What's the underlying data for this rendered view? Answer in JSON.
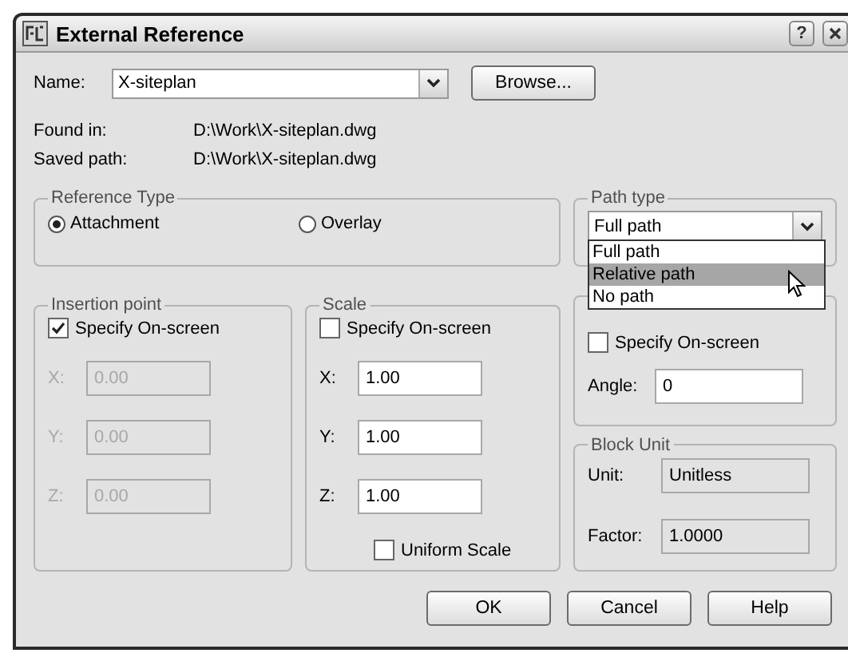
{
  "window": {
    "title": "External Reference",
    "help_button": "?"
  },
  "name": {
    "label": "Name:",
    "value": "X-siteplan"
  },
  "browse_button": "Browse...",
  "info": [
    {
      "label": "Found in:",
      "value": "D:\\Work\\X-siteplan.dwg"
    },
    {
      "label": "Saved path:",
      "value": "D:\\Work\\X-siteplan.dwg"
    }
  ],
  "reference_type": {
    "title": "Reference Type",
    "options": [
      {
        "label": "Attachment",
        "selected": true
      },
      {
        "label": "Overlay",
        "selected": false
      }
    ]
  },
  "path_type": {
    "title": "Path type",
    "value": "Full path",
    "expanded": true,
    "options": [
      {
        "label": "Full path",
        "highlighted": false
      },
      {
        "label": "Relative path",
        "highlighted": true
      },
      {
        "label": "No path",
        "highlighted": false
      }
    ]
  },
  "insertion_point": {
    "title": "Insertion point",
    "specify_on_screen": {
      "label": "Specify On-screen",
      "checked": true
    },
    "fields": [
      {
        "label": "X:",
        "value": "0.00",
        "disabled": true
      },
      {
        "label": "Y:",
        "value": "0.00",
        "disabled": true
      },
      {
        "label": "Z:",
        "value": "0.00",
        "disabled": true
      }
    ]
  },
  "scale": {
    "title": "Scale",
    "specify_on_screen": {
      "label": "Specify On-screen",
      "checked": false
    },
    "fields": [
      {
        "label": "X:",
        "value": "1.00",
        "disabled": false
      },
      {
        "label": "Y:",
        "value": "1.00",
        "disabled": false
      },
      {
        "label": "Z:",
        "value": "1.00",
        "disabled": false
      }
    ],
    "uniform_scale": {
      "label": "Uniform Scale",
      "checked": false
    }
  },
  "rotation": {
    "specify_on_screen": {
      "label": "Specify On-screen",
      "checked": false
    },
    "angle": {
      "label": "Angle:",
      "value": "0"
    }
  },
  "block_unit": {
    "title": "Block Unit",
    "unit": {
      "label": "Unit:",
      "value": "Unitless"
    },
    "factor": {
      "label": "Factor:",
      "value": "1.0000"
    }
  },
  "buttons": [
    "OK",
    "Cancel",
    "Help"
  ]
}
